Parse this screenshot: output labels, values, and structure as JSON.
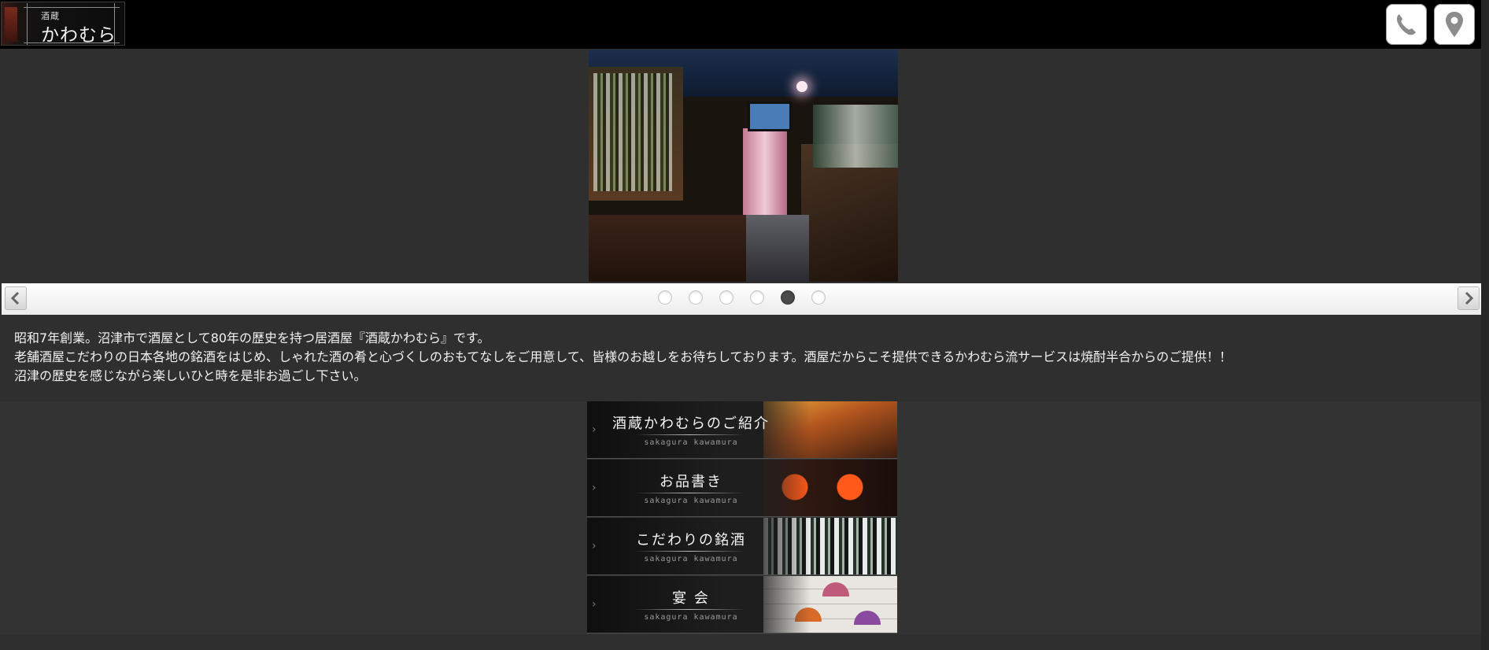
{
  "header": {
    "logo_small": "酒蔵",
    "logo_big": "かわむら",
    "phone_icon": "phone-icon",
    "map_icon": "map-pin-icon"
  },
  "slider": {
    "dot_count": 6,
    "active_index": 4,
    "prev_icon": "chevron-left-icon",
    "next_icon": "chevron-right-icon"
  },
  "intro": {
    "line1": "昭和7年創業。沼津市で酒屋として80年の歴史を持つ居酒屋『酒蔵かわむら』です。",
    "line2": "老舗酒屋こだわりの日本各地の銘酒をはじめ、しゃれた酒の肴と心づくしのおもてなしをご用意して、皆様のお越しをお待ちしております。酒屋だからこそ提供できるかわむら流サービスは焼酎半合からのご提供！！",
    "line3": "沼津の歴史を感じながら楽しいひと時を是非お過ごし下さい。"
  },
  "menu": {
    "items": [
      {
        "title": "酒蔵かわむらのご紹介",
        "sub": "sakagura kawamura"
      },
      {
        "title": "お品書き",
        "sub": "sakagura kawamura"
      },
      {
        "title": "こだわりの銘酒",
        "sub": "sakagura kawamura"
      },
      {
        "title": "宴 会",
        "sub": "sakagura kawamura"
      }
    ]
  }
}
